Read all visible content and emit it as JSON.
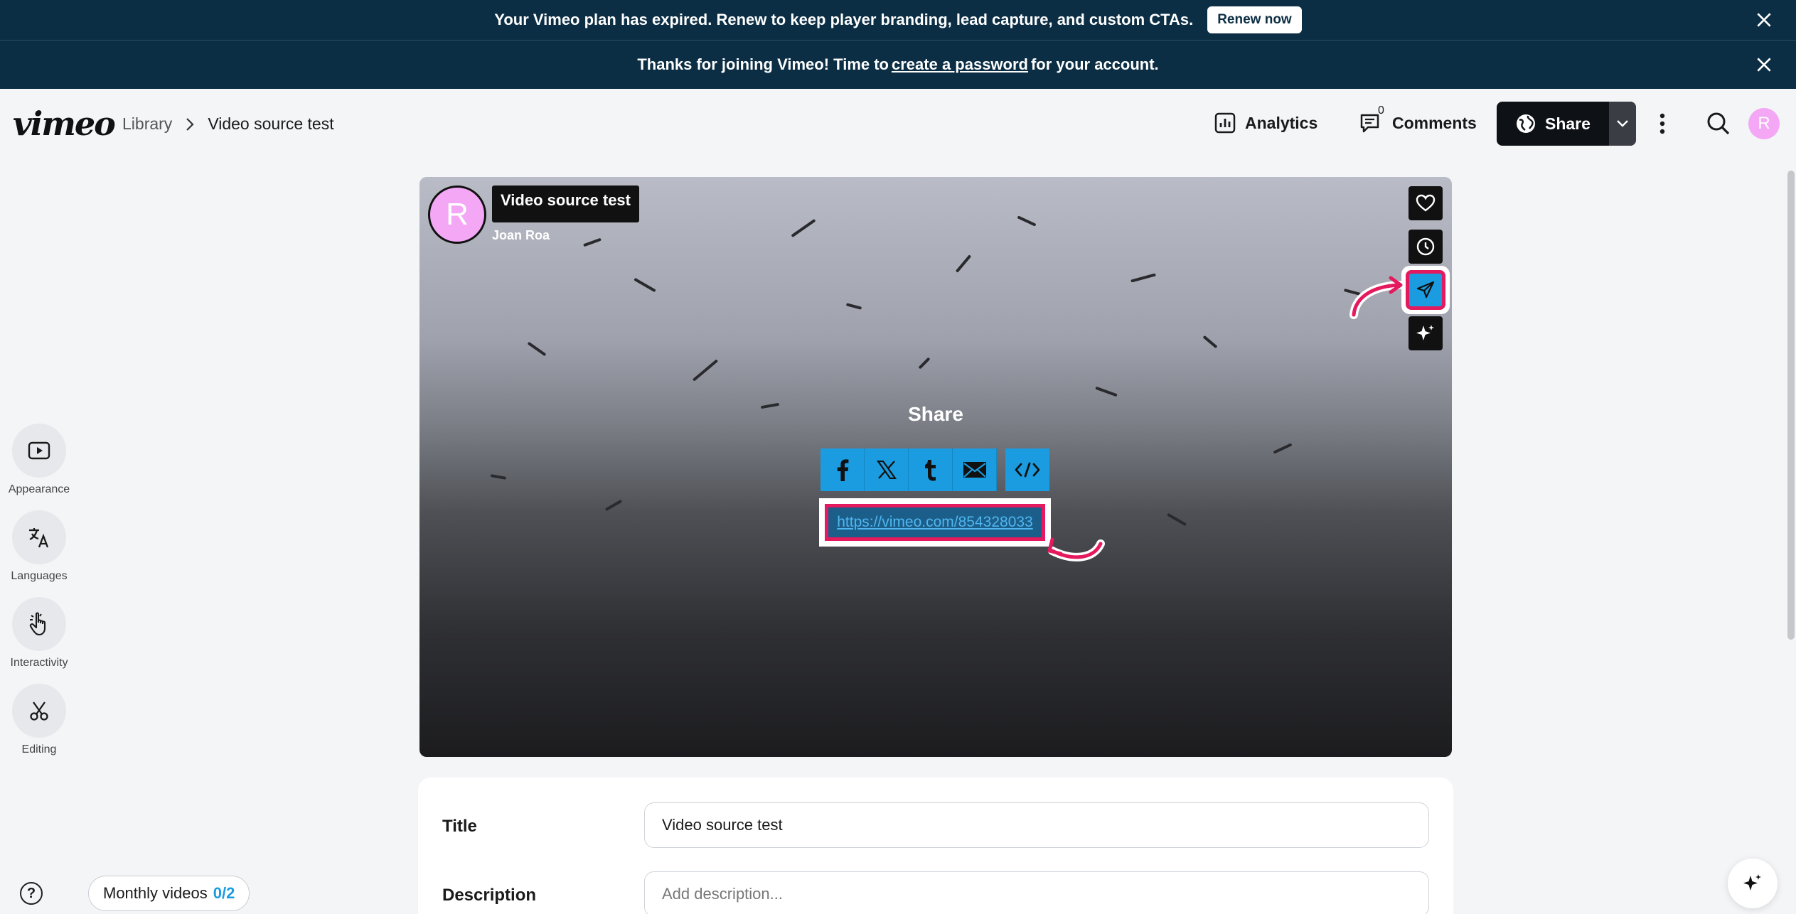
{
  "banners": {
    "plan": {
      "text": "Your Vimeo plan has expired. Renew to keep player branding, lead capture, and custom CTAs.",
      "button": "Renew now"
    },
    "welcome": {
      "before": "Thanks for joining Vimeo! Time to",
      "link": "create a password",
      "after": "for your account."
    }
  },
  "header": {
    "logo": "vimeo",
    "breadcrumb": {
      "library": "Library",
      "current": "Video source test"
    },
    "analytics": "Analytics",
    "comments": "Comments",
    "comments_count": "0",
    "share": "Share",
    "avatar_initial": "R"
  },
  "rail": [
    {
      "label": "Appearance"
    },
    {
      "label": "Languages"
    },
    {
      "label": "Interactivity"
    },
    {
      "label": "Editing"
    }
  ],
  "player": {
    "avatar_initial": "R",
    "title": "Video source test",
    "author": "Joan Roa",
    "share_title": "Share",
    "share_url": "https://vimeo.com/854328033"
  },
  "form": {
    "title_label": "Title",
    "title_value": "Video source test",
    "description_label": "Description",
    "description_placeholder": "Add description..."
  },
  "footer": {
    "monthly_label": "Monthly videos",
    "monthly_count": "0/2"
  },
  "colors": {
    "brand_dark": "#0b2e44",
    "accent_blue": "#1b9ce0",
    "highlight": "#e5195e"
  }
}
